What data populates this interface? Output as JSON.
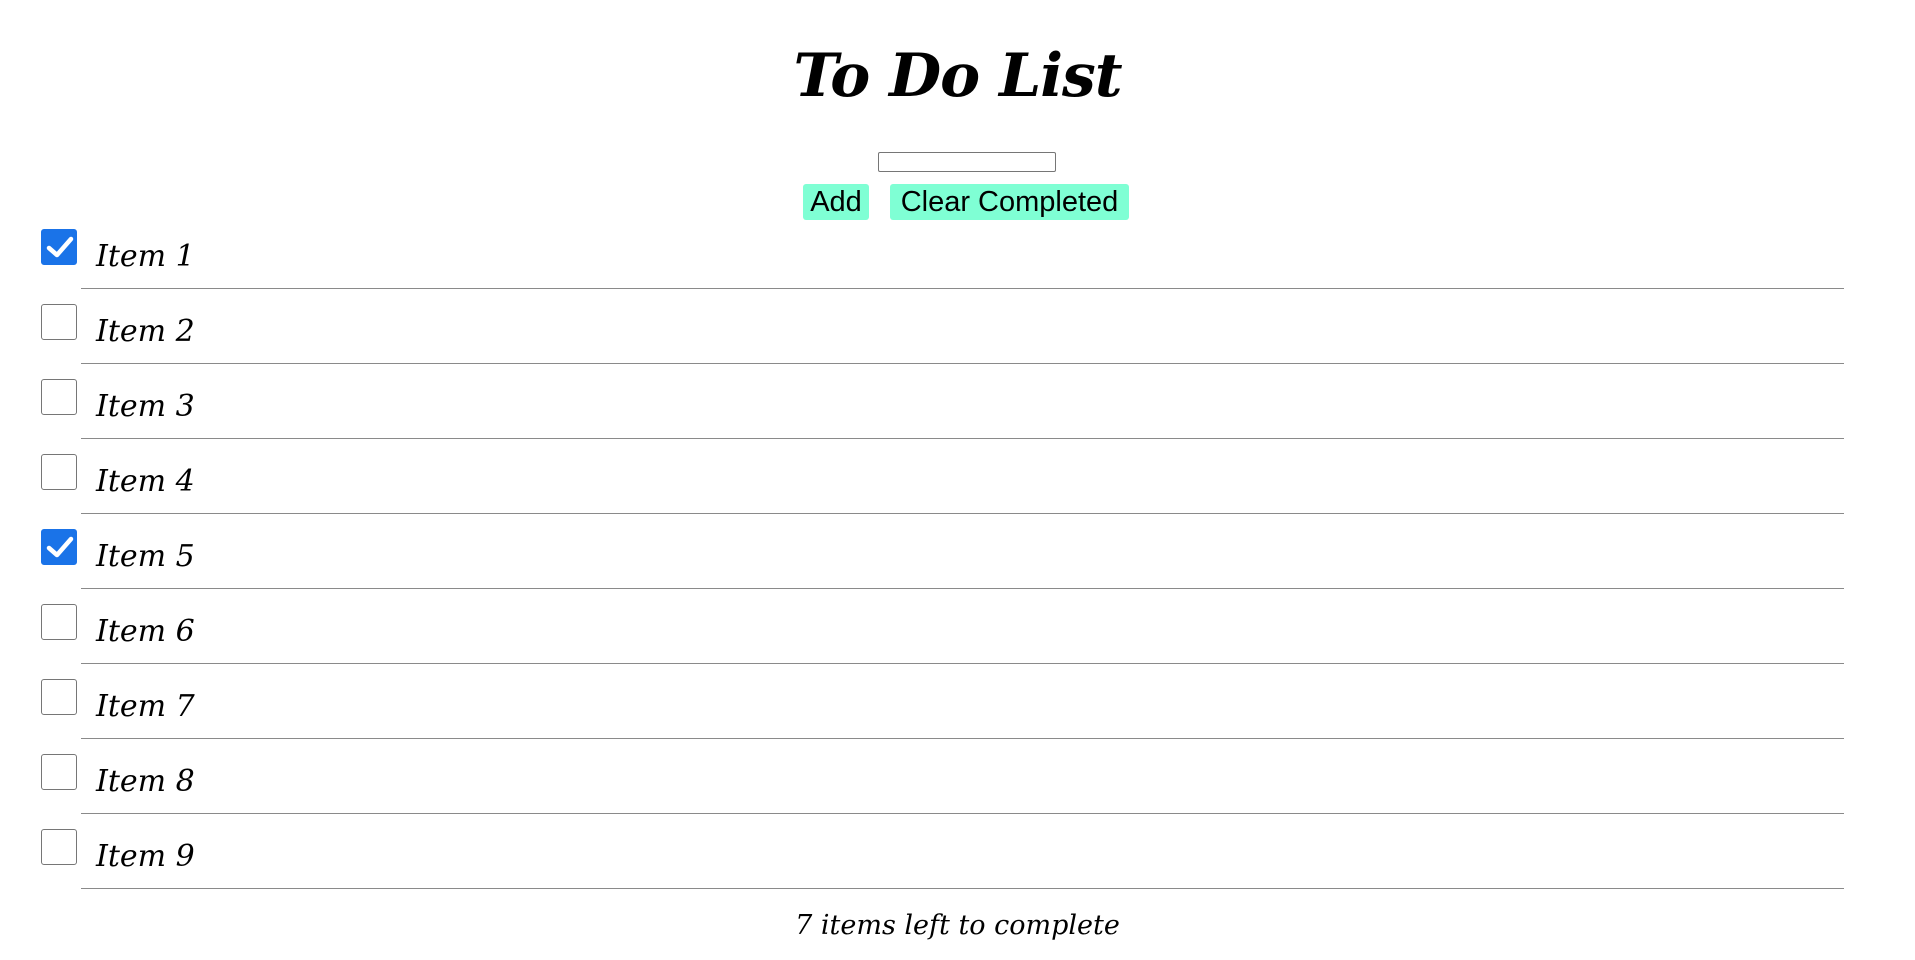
{
  "header": {
    "title": "To Do List"
  },
  "form": {
    "input_value": "",
    "add_label": "Add",
    "clear_label": "Clear Completed"
  },
  "todos": [
    {
      "label": "Item 1",
      "checked": true
    },
    {
      "label": "Item 2",
      "checked": false
    },
    {
      "label": "Item 3",
      "checked": false
    },
    {
      "label": "Item 4",
      "checked": false
    },
    {
      "label": "Item 5",
      "checked": true
    },
    {
      "label": "Item 6",
      "checked": false
    },
    {
      "label": "Item 7",
      "checked": false
    },
    {
      "label": "Item 8",
      "checked": false
    },
    {
      "label": "Item 9",
      "checked": false
    }
  ],
  "footer": {
    "remaining_text": "7 items left to complete"
  },
  "colors": {
    "button_bg": "#7fffd4",
    "checkbox_checked": "#1a73e8"
  },
  "icons": {
    "checkbox": "checkmark-icon"
  }
}
